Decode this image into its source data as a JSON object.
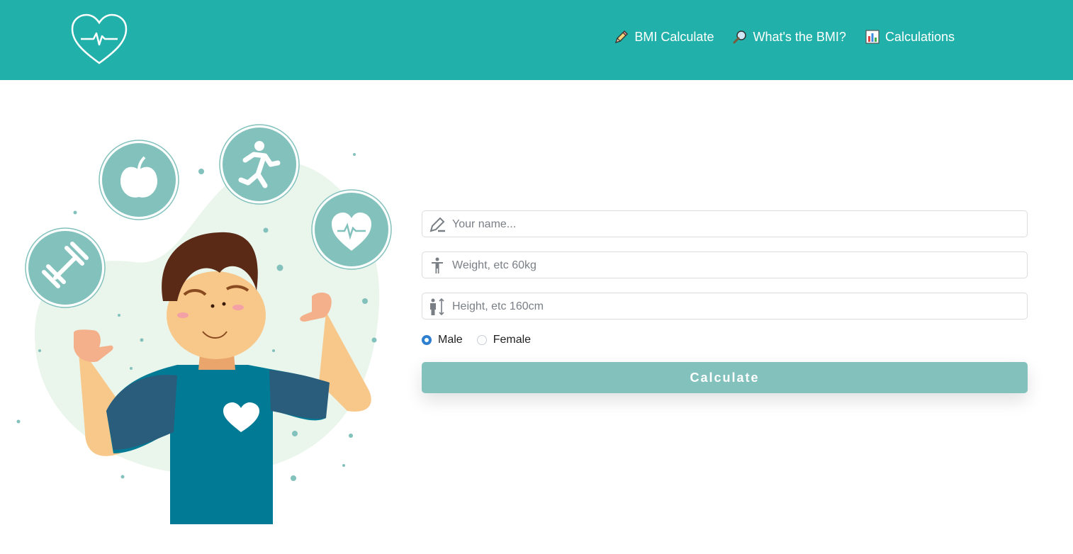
{
  "colors": {
    "header_bg": "#22b1aa",
    "accent": "#83c1bd",
    "radio_selected": "#2f7fd0"
  },
  "header": {
    "logo_icon": "heart-pulse-icon",
    "nav": [
      {
        "label": "BMI Calculate",
        "icon": "pencil-icon"
      },
      {
        "label": "What's the BMI?",
        "icon": "magnifier-icon"
      },
      {
        "label": "Calculations",
        "icon": "bar-chart-icon"
      }
    ]
  },
  "form": {
    "name_placeholder": "Your name...",
    "weight_placeholder": "Weight, etc 60kg",
    "height_placeholder": "Height, etc 160cm",
    "gender_options": [
      {
        "label": "Male",
        "selected": true
      },
      {
        "label": "Female",
        "selected": false
      }
    ],
    "calculate_label": "Calculate"
  }
}
